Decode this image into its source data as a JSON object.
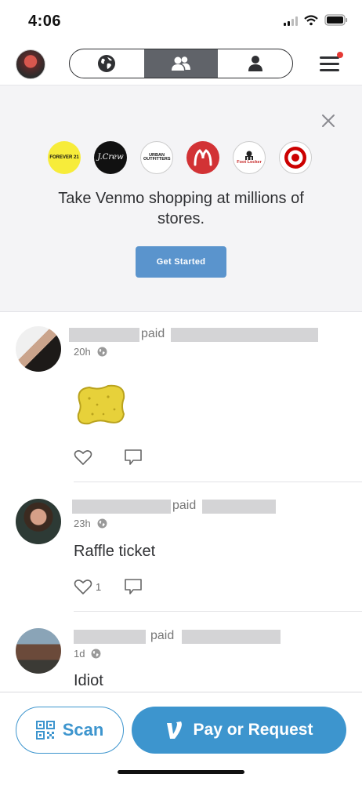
{
  "status_bar": {
    "time": "4:06"
  },
  "banner": {
    "logos": [
      {
        "name": "forever21",
        "text": "FOREVER 21"
      },
      {
        "name": "jcrew",
        "text": "J.Crew"
      },
      {
        "name": "urban-outfitters",
        "text": "URBAN OUTFITTERS"
      },
      {
        "name": "lululemon",
        "text": ""
      },
      {
        "name": "foot-locker",
        "text": "Foot Locker"
      },
      {
        "name": "target",
        "text": ""
      }
    ],
    "text": "Take Venmo shopping at millions of stores.",
    "cta_label": "Get Started"
  },
  "feed": [
    {
      "paid_label": "paid",
      "time": "20h",
      "likes": ""
    },
    {
      "paid_label": "paid",
      "time": "23h",
      "note": "Raffle ticket",
      "likes": "1"
    },
    {
      "paid_label": "paid",
      "time": "1d",
      "note": "Idiot"
    }
  ],
  "bottom_bar": {
    "scan_label": "Scan",
    "pay_label": "Pay or Request"
  },
  "colors": {
    "venmo_blue": "#3d95ce",
    "banner_button": "#5a94cd",
    "notification": "#e53935"
  }
}
